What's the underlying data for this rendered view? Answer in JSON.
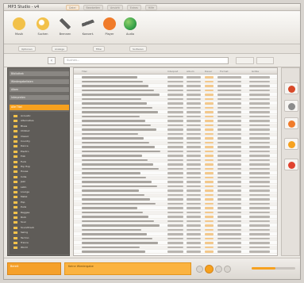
{
  "window": {
    "title": "MP3 Studio - v4",
    "tabs": [
      "Datei",
      "Bearbeiten",
      "Ansicht",
      "Extras",
      "Hilfe"
    ]
  },
  "toolbar": {
    "items": [
      {
        "label": "Musik",
        "icon": "music-icon",
        "color": "#f2c14a"
      },
      {
        "label": "Suchen",
        "icon": "search-icon",
        "color": "#f2c14a"
      },
      {
        "label": "Brennen",
        "icon": "tools-icon",
        "color": "#5e5e5e"
      },
      {
        "label": "Konvert.",
        "icon": "pencil-icon",
        "color": "#5e5e5e"
      },
      {
        "label": "Player",
        "icon": "hands-icon",
        "color": "#f07b2a"
      },
      {
        "label": "Audio",
        "icon": "globe-icon",
        "color": "#38a24a"
      }
    ]
  },
  "subbar": {
    "buttons": [
      "Optionen",
      "Anzeige",
      "Filter",
      "Sortieren"
    ]
  },
  "search": {
    "placeholder": "Suchen..."
  },
  "sidebar": {
    "headers": [
      "Bibliothek",
      "Wiedergabelisten",
      "Alben",
      "Interpreten"
    ],
    "selected": "Alle Titel",
    "items": [
      "Acoustic",
      "Alternative",
      "Blues",
      "Chillout",
      "Classic",
      "Country",
      "Dance",
      "Electro",
      "Folk",
      "Funk",
      "Hip Hop",
      "House",
      "Indie",
      "Jazz",
      "Latin",
      "Lounge",
      "Metal",
      "Pop",
      "Punk",
      "Reggae",
      "Rock",
      "Soul",
      "Soundtrack",
      "Swing",
      "Techno",
      "Trance",
      "World"
    ]
  },
  "list": {
    "columns": [
      "Titel",
      "Interpret",
      "Album",
      "Dauer",
      "Format",
      "Größe"
    ],
    "row_count": 41,
    "highlight_color": "#f2c88c"
  },
  "right_panel": {
    "buttons": [
      "refresh-icon",
      "export-icon",
      "burn-icon",
      "edit-icon",
      "tag-icon"
    ]
  },
  "bottom": {
    "status_left": "Bereit",
    "status_main": "Keine Wiedergabe",
    "volume": 0.55,
    "accent": "#f6a11f"
  }
}
